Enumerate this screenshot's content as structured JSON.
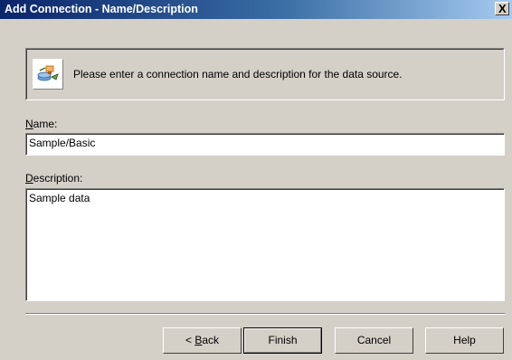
{
  "window": {
    "title": "Add Connection - Name/Description",
    "close_label": "X"
  },
  "header": {
    "message": "Please enter a connection name and description for the data source.",
    "icon": "connection-wizard-icon"
  },
  "name_field": {
    "label_accel": "N",
    "label_rest": "ame:",
    "value": "Sample/Basic"
  },
  "description_field": {
    "label_accel": "D",
    "label_rest": "escription:",
    "value": "Sample data"
  },
  "buttons": {
    "back_prefix": "< ",
    "back_accel": "B",
    "back_rest": "ack",
    "finish": "Finish",
    "cancel": "Cancel",
    "help": "Help"
  }
}
